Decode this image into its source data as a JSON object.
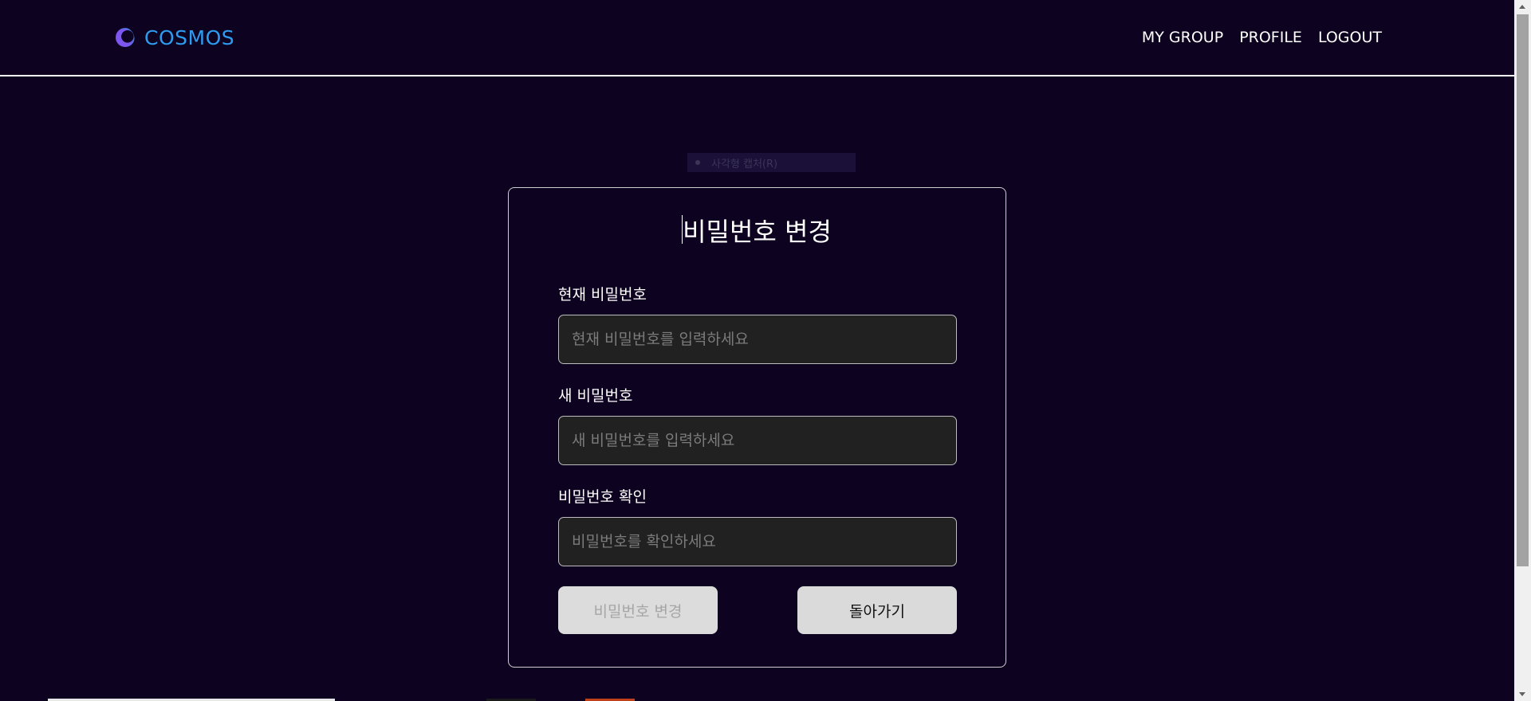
{
  "header": {
    "brand": "COSMOS",
    "nav": [
      "MY GROUP",
      "PROFILE",
      "LOGOUT"
    ]
  },
  "tooltip": {
    "label": "사각형 캡처(R)"
  },
  "form": {
    "title": "비밀번호 변경",
    "fields": [
      {
        "label": "현재 비밀번호",
        "placeholder": "현재 비밀번호를 입력하세요"
      },
      {
        "label": "새 비밀번호",
        "placeholder": "새 비밀번호를 입력하세요"
      },
      {
        "label": "비밀번호 확인",
        "placeholder": "비밀번호를 확인하세요"
      }
    ],
    "submit_label": "비밀번호 변경",
    "back_label": "돌아가기"
  },
  "colors": {
    "background": "#0d0220",
    "brand": "#2d9cf0",
    "input_bg": "#212121",
    "button_bg": "#dcdcdc"
  }
}
